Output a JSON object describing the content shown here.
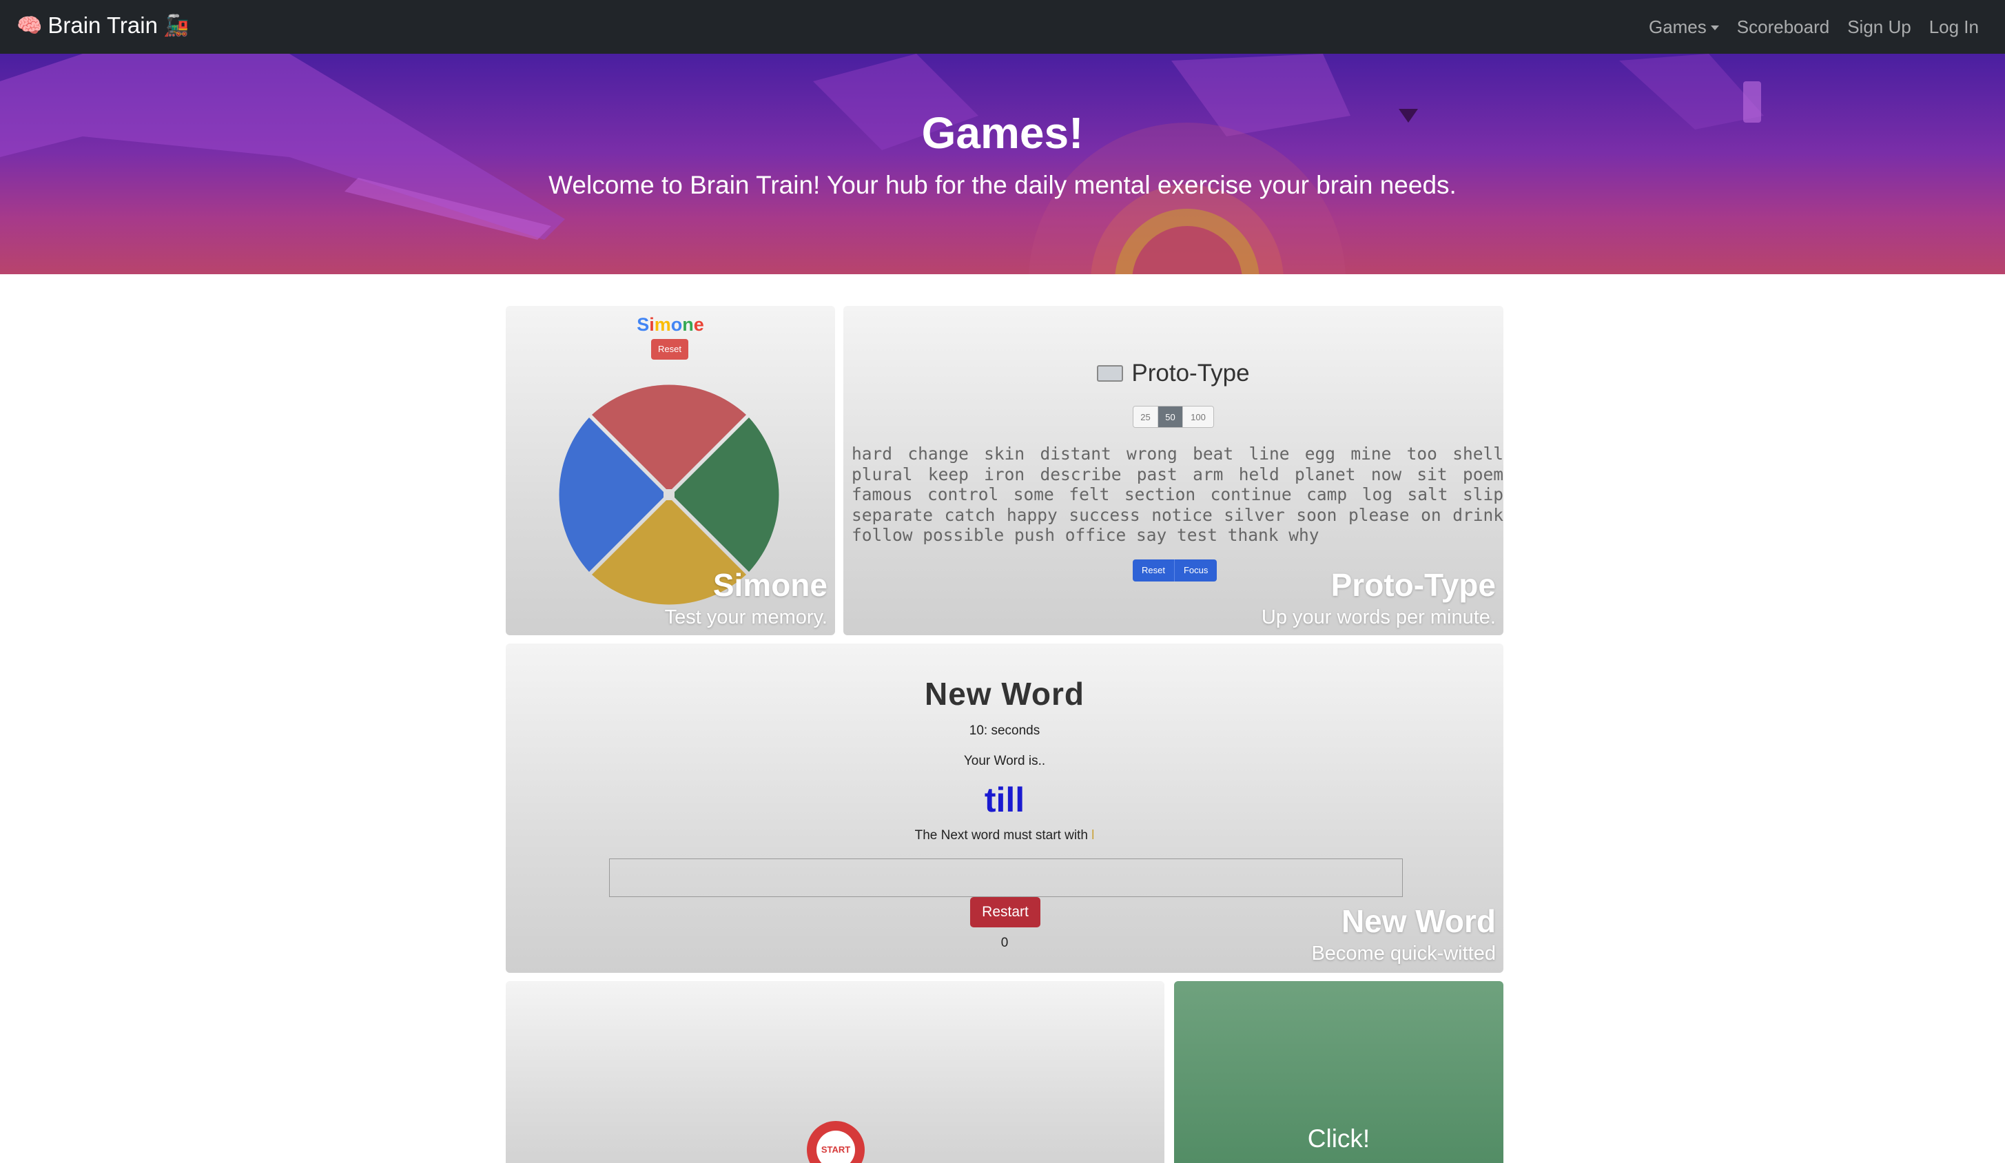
{
  "navbar": {
    "brand": "Brain Train",
    "brand_emoji_left": "🧠",
    "brand_emoji_right": "🚂",
    "links": [
      {
        "label": "Games",
        "has_dropdown": true
      },
      {
        "label": "Scoreboard"
      },
      {
        "label": "Sign Up"
      },
      {
        "label": "Log In"
      }
    ]
  },
  "hero": {
    "title": "Games!",
    "subtitle": "Welcome to Brain Train! Your hub for the daily mental exercise your brain needs."
  },
  "simone": {
    "name_letters": [
      "S",
      "i",
      "m",
      "o",
      "n",
      "e"
    ],
    "name_colors": [
      "#4285f4",
      "#ea4335",
      "#fbbc05",
      "#4285f4",
      "#34a853",
      "#ea4335"
    ],
    "reset_label": "Reset",
    "quadrant_colors": {
      "top": "#c0595c",
      "right": "#3f7a52",
      "bottom": "#c9a13a",
      "left": "#3f6fd1"
    },
    "card_title": "Simone",
    "card_subtitle": "Test your memory."
  },
  "prototype": {
    "title": "Proto-Type",
    "word_counts": [
      "25",
      "50",
      "100"
    ],
    "active_count": "50",
    "word_lines": [
      "hard change skin distant wrong beat line egg mine too shell",
      "plural keep iron describe past arm held planet now sit poem",
      "famous control some felt section continue camp log salt slip",
      "separate catch happy success notice silver soon please on drink",
      "follow possible push office say test thank why"
    ],
    "reset_label": "Reset",
    "focus_label": "Focus",
    "card_title": "Proto-Type",
    "card_subtitle": "Up your words per minute."
  },
  "newword": {
    "title": "New Word",
    "timer": "10: seconds",
    "your_word_label": "Your Word is..",
    "current_word": "till",
    "next_hint_prefix": "The Next word must start with ",
    "next_letter": "l",
    "input_value": "",
    "restart_label": "Restart",
    "score": "0",
    "card_title": "New Word",
    "card_subtitle": "Become quick-witted"
  },
  "reaction": {
    "start_label": "START"
  },
  "clicker": {
    "label": "Click!"
  }
}
